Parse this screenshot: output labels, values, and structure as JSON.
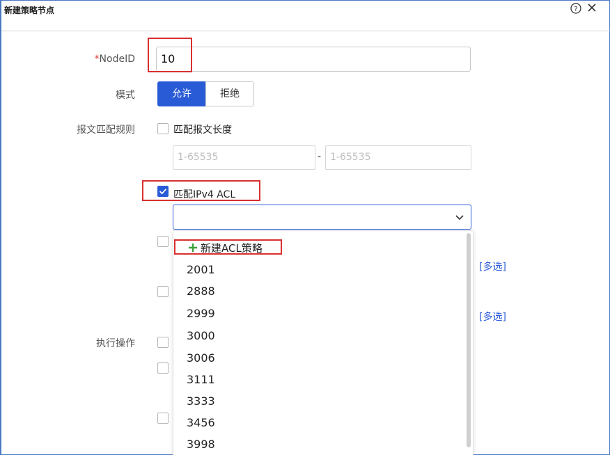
{
  "dialog": {
    "title": "新建策略节点",
    "help_icon": "help-circle-icon",
    "close_icon": "close-icon"
  },
  "form": {
    "nodeid_required_mark": "*",
    "nodeid_label": "NodeID",
    "nodeid_value": "10",
    "mode_label": "模式",
    "mode_options": [
      "允许",
      "拒绝"
    ],
    "mode_selected": "允许",
    "match_rules_label": "报文匹配规则",
    "match_length_label": "匹配报文长度",
    "match_length_checked": false,
    "range_min_placeholder": "1-65535",
    "range_separator": "-",
    "range_max_placeholder": "1-65535",
    "match_ipv4_acl_label": "匹配IPv4 ACL",
    "match_ipv4_acl_checked": true,
    "acl_select_value": "",
    "multi_select_link_1": "[多选]",
    "multi_select_link_2": "[多选]",
    "action_label": "执行操作"
  },
  "acl_dropdown": {
    "new_item_label": "新建ACL策略",
    "new_item_icon": "plus-icon",
    "items": [
      "2001",
      "2888",
      "2999",
      "3000",
      "3006",
      "3111",
      "3333",
      "3456",
      "3998"
    ]
  },
  "colors": {
    "accent": "#2a5bd7",
    "highlight_box": "#d93030",
    "required": "#e03c3c",
    "plus_icon": "#3aa23a"
  }
}
